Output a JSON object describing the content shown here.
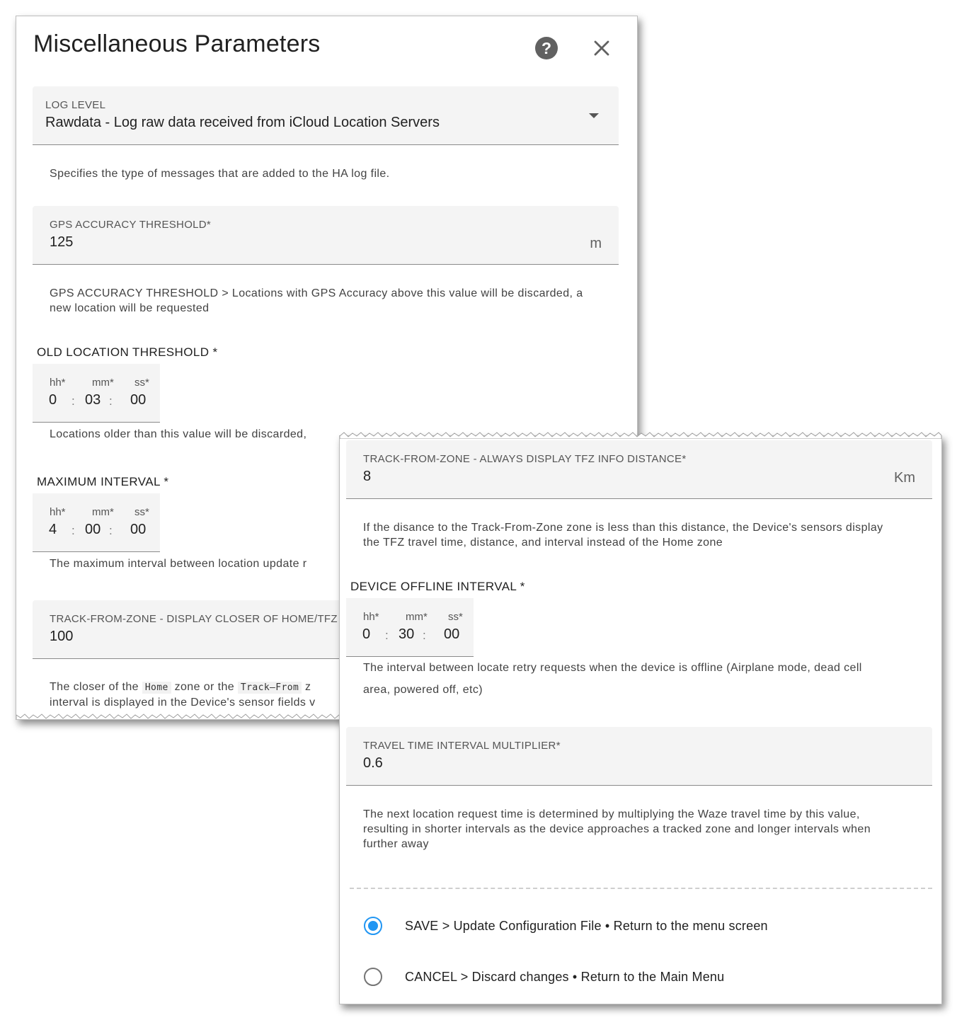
{
  "dialog": {
    "title": "Miscellaneous Parameters",
    "icons": {
      "help": "help-circle-icon",
      "close": "close-icon"
    }
  },
  "log_level": {
    "label": "LOG LEVEL",
    "value": "Rawdata - Log raw data received from iCloud Location Servers",
    "helper": "Specifies the type of messages that are added to the HA log file."
  },
  "gps_accuracy": {
    "label": "GPS ACCURACY THRESHOLD*",
    "value": "125",
    "unit": "m",
    "helper_line1": "GPS ACCURACY THRESHOLD > Locations with GPS Accuracy above this value will be discarded, a",
    "helper_line2": "new location will be requested"
  },
  "old_location": {
    "label": "OLD LOCATION THRESHOLD *",
    "hh_label": "hh*",
    "mm_label": "mm*",
    "ss_label": "ss*",
    "hh": "0",
    "mm": "03",
    "ss": "00",
    "helper": "Locations older than this value will be discarded,"
  },
  "max_interval": {
    "label": "MAXIMUM INTERVAL *",
    "hh_label": "hh*",
    "mm_label": "mm*",
    "ss_label": "ss*",
    "hh": "4",
    "mm": "00",
    "ss": "00",
    "helper": "The maximum interval between location update r"
  },
  "tfz_display": {
    "label": "TRACK-FROM-ZONE - DISPLAY CLOSER OF HOME/TFZ",
    "value": "100",
    "helper_a": "The closer of the ",
    "helper_code1": "Home",
    "helper_b": " zone or the ",
    "helper_code2": "Track–From",
    "helper_c": " z",
    "helper_line2": "interval is displayed in the Device's sensor fields v"
  },
  "tfz_distance": {
    "label": "TRACK-FROM-ZONE - ALWAYS DISPLAY TFZ INFO DISTANCE*",
    "value": "8",
    "unit": "Km",
    "helper_line1": "If the disance to the Track-From-Zone zone is less than this distance, the Device's sensors display",
    "helper_line2": "the TFZ travel time, distance, and interval instead of the Home zone"
  },
  "offline_interval": {
    "label": "DEVICE OFFLINE INTERVAL *",
    "hh_label": "hh*",
    "mm_label": "mm*",
    "ss_label": "ss*",
    "hh": "0",
    "mm": "30",
    "ss": "00",
    "helper_line1": "The interval between locate retry requests when the device is offline (Airplane mode, dead cell",
    "helper_line2": "area, powered off, etc)"
  },
  "travel_multiplier": {
    "label": "TRAVEL TIME INTERVAL MULTIPLIER*",
    "value": "0.6",
    "helper_line1": "The next location request time is determined by multiplying the Waze travel time by this value,",
    "helper_line2": "resulting in shorter intervals as the device approaches a tracked zone and longer intervals when",
    "helper_line3": "further away"
  },
  "actions": {
    "save": {
      "label": "SAVE > Update Configuration File • Return to the menu screen",
      "selected": true
    },
    "cancel": {
      "label": "CANCEL > Discard changes • Return to the Main Menu",
      "selected": false
    }
  },
  "colors": {
    "accent": "#2196f3",
    "field_bg": "#f4f4f4"
  }
}
